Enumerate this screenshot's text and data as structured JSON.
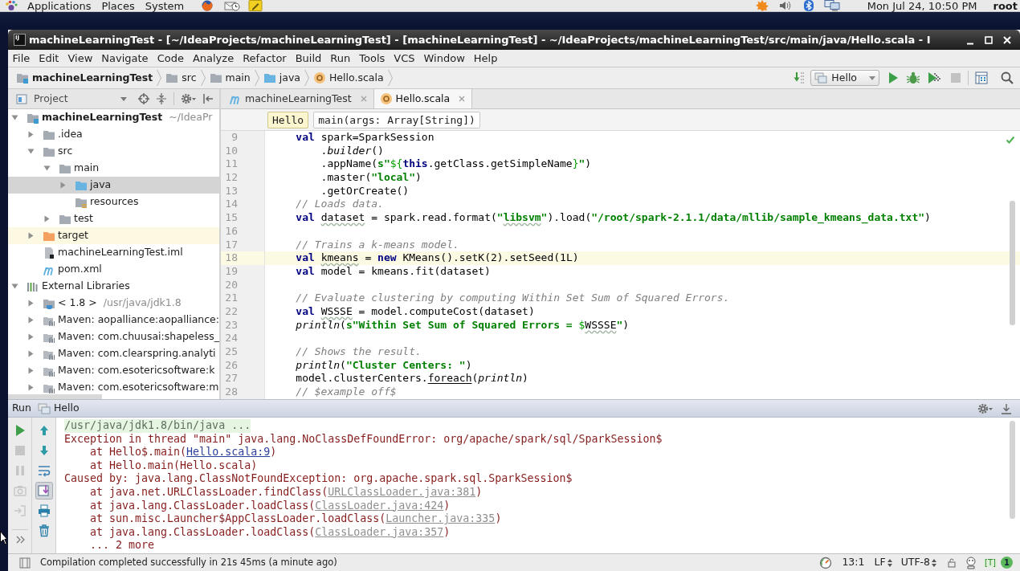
{
  "top_panel": {
    "menus": [
      "Applications",
      "Places",
      "System"
    ],
    "clock": "Mon Jul 24, 10:50 PM",
    "user": "root"
  },
  "window": {
    "icon_label": "IJ",
    "title": "machineLearningTest - [~/IdeaProjects/machineLearningTest] - [machineLearningTest] - ~/IdeaProjects/machineLearningTest/src/main/java/Hello.scala - I"
  },
  "menu_bar": [
    "File",
    "Edit",
    "View",
    "Navigate",
    "Code",
    "Analyze",
    "Refactor",
    "Build",
    "Run",
    "Tools",
    "VCS",
    "Window",
    "Help"
  ],
  "navigation_bar": {
    "breadcrumbs": [
      {
        "label": "machineLearningTest",
        "kind": "module"
      },
      {
        "label": "src",
        "kind": "folder"
      },
      {
        "label": "main",
        "kind": "folder"
      },
      {
        "label": "java",
        "kind": "source-folder"
      },
      {
        "label": "Hello.scala",
        "kind": "scala-object"
      }
    ],
    "toolbar": [
      {
        "kind": "build",
        "disabled": false
      },
      {
        "kind": "run-configuration",
        "label": "Hello",
        "disabled": false
      },
      {
        "kind": "run",
        "disabled": false
      },
      {
        "kind": "debug",
        "disabled": false
      },
      {
        "kind": "coverage",
        "disabled": false
      },
      {
        "kind": "stop",
        "disabled": true
      },
      {
        "kind": "separator"
      },
      {
        "kind": "project-structure",
        "disabled": false
      },
      {
        "kind": "search",
        "disabled": false
      }
    ]
  },
  "project_panel": {
    "title": "Project",
    "tree": [
      {
        "label": "machineLearningTest",
        "hint": "~/IdeaPr",
        "kind": "module",
        "expanded": true,
        "selected": false,
        "hovered": false,
        "children": [
          {
            "label": ".idea",
            "kind": "folder",
            "expanded": false,
            "selected": false,
            "hovered": false
          },
          {
            "label": "src",
            "kind": "folder",
            "expanded": true,
            "selected": false,
            "hovered": false,
            "children": [
              {
                "label": "main",
                "kind": "folder",
                "expanded": true,
                "selected": false,
                "hovered": false,
                "children": [
                  {
                    "label": "java",
                    "kind": "source-folder",
                    "expanded": false,
                    "selected": true,
                    "hovered": false
                  },
                  {
                    "label": "resources",
                    "kind": "resource-folder",
                    "selected": false,
                    "hovered": false
                  }
                ]
              },
              {
                "label": "test",
                "kind": "folder",
                "expanded": false,
                "selected": false,
                "hovered": false
              }
            ]
          },
          {
            "label": "target",
            "kind": "excluded-folder",
            "expanded": false,
            "selected": false,
            "hovered": true
          },
          {
            "label": "machineLearningTest.iml",
            "kind": "module-file",
            "selected": false,
            "hovered": false
          },
          {
            "label": "pom.xml",
            "kind": "maven-file",
            "selected": false,
            "hovered": false
          }
        ]
      },
      {
        "label": "External Libraries",
        "kind": "libraries",
        "expanded": true,
        "selected": false,
        "hovered": false,
        "children": [
          {
            "label": "< 1.8 >",
            "hint": "/usr/java/jdk1.8",
            "kind": "jdk",
            "expanded": false,
            "selected": false,
            "hovered": false
          },
          {
            "label": "Maven: aopalliance:aopalliance:",
            "kind": "library",
            "expanded": false,
            "selected": false,
            "hovered": false
          },
          {
            "label": "Maven: com.chuusai:shapeless_",
            "kind": "library",
            "expanded": false,
            "selected": false,
            "hovered": false
          },
          {
            "label": "Maven: com.clearspring.analyti",
            "kind": "library",
            "expanded": false,
            "selected": false,
            "hovered": false
          },
          {
            "label": "Maven: com.esotericsoftware:k",
            "kind": "library",
            "expanded": false,
            "selected": false,
            "hovered": false
          },
          {
            "label": "Maven: com.esotericsoftware:m",
            "kind": "library",
            "expanded": false,
            "selected": false,
            "hovered": false
          }
        ]
      }
    ]
  },
  "editor": {
    "tabs": [
      {
        "label": "machineLearningTest",
        "kind": "maven-file",
        "selected": false
      },
      {
        "label": "Hello.scala",
        "kind": "scala-object",
        "selected": true
      }
    ],
    "breadcrumbs": [
      {
        "label": "Hello",
        "selected": true
      },
      {
        "label": "main(args: Array[String])",
        "selected": false
      }
    ],
    "lines": [
      {
        "number": "9",
        "current": false,
        "tokens": [
          {
            "kind": "keyword",
            "text": "    val "
          },
          {
            "kind": "plain",
            "text": "spark=SparkSession"
          }
        ]
      },
      {
        "number": "10",
        "current": false,
        "tokens": [
          {
            "kind": "plain",
            "text": "        ."
          },
          {
            "kind": "method",
            "text": "builder"
          },
          {
            "kind": "plain",
            "text": "()"
          }
        ]
      },
      {
        "number": "11",
        "current": false,
        "tokens": [
          {
            "kind": "plain",
            "text": "        .appName("
          },
          {
            "kind": "string",
            "text": "s\""
          },
          {
            "kind": "interpolation",
            "text": "${"
          },
          {
            "kind": "keyword",
            "text": "this"
          },
          {
            "kind": "plain",
            "text": ".getClass.getSimpleName"
          },
          {
            "kind": "interpolation",
            "text": "}"
          },
          {
            "kind": "string",
            "text": "\""
          },
          {
            "kind": "plain",
            "text": ")"
          }
        ]
      },
      {
        "number": "12",
        "current": false,
        "tokens": [
          {
            "kind": "plain",
            "text": "        .master("
          },
          {
            "kind": "string",
            "text": "\"local\""
          },
          {
            "kind": "plain",
            "text": ")"
          }
        ]
      },
      {
        "number": "13",
        "current": false,
        "tokens": [
          {
            "kind": "plain",
            "text": "        .getOrCreate()"
          }
        ]
      },
      {
        "number": "14",
        "current": false,
        "tokens": [
          {
            "kind": "comment",
            "text": "    // Loads data."
          }
        ]
      },
      {
        "number": "15",
        "current": false,
        "tokens": [
          {
            "kind": "keyword",
            "text": "    val "
          },
          {
            "kind": "typo",
            "text": "dataset"
          },
          {
            "kind": "plain",
            "text": " = spark.read.format("
          },
          {
            "kind": "string",
            "text": "\""
          },
          {
            "kind": "string-typo",
            "text": "libsvm"
          },
          {
            "kind": "string",
            "text": "\""
          },
          {
            "kind": "plain",
            "text": ").load("
          },
          {
            "kind": "string",
            "text": "\"/root/spark-2.1.1/data/mllib/sample_kmeans_data.txt\""
          },
          {
            "kind": "plain",
            "text": ")"
          }
        ]
      },
      {
        "number": "16",
        "current": false
      },
      {
        "number": "17",
        "current": false,
        "tokens": [
          {
            "kind": "comment",
            "text": "    // Trains a k-means model."
          }
        ]
      },
      {
        "number": "18",
        "current": true,
        "tokens": [
          {
            "kind": "keyword",
            "text": "    val "
          },
          {
            "kind": "typo",
            "text": "kmeans"
          },
          {
            "kind": "plain",
            "text": " = "
          },
          {
            "kind": "keyword",
            "text": "new"
          },
          {
            "kind": "plain",
            "text": " KMeans().setK(2).setSeed(1L)"
          }
        ]
      },
      {
        "number": "19",
        "current": false,
        "tokens": [
          {
            "kind": "keyword",
            "text": "    val "
          },
          {
            "kind": "plain",
            "text": "model = kmeans.fit(dataset)"
          }
        ]
      },
      {
        "number": "20",
        "current": false
      },
      {
        "number": "21",
        "current": false,
        "tokens": [
          {
            "kind": "comment",
            "text": "    // Evaluate clustering by computing Within Set Sum of Squared Errors."
          }
        ]
      },
      {
        "number": "22",
        "current": false,
        "tokens": [
          {
            "kind": "keyword",
            "text": "    val "
          },
          {
            "kind": "typo",
            "text": "WSSSE"
          },
          {
            "kind": "plain",
            "text": " = model.computeCost(dataset)"
          }
        ]
      },
      {
        "number": "23",
        "current": false,
        "tokens": [
          {
            "kind": "method",
            "text": "    println"
          },
          {
            "kind": "plain",
            "text": "("
          },
          {
            "kind": "string",
            "text": "s\"Within Set Sum of Squared Errors = "
          },
          {
            "kind": "interpolation",
            "text": "$"
          },
          {
            "kind": "typo",
            "text": "WSSSE"
          },
          {
            "kind": "string",
            "text": "\""
          },
          {
            "kind": "plain",
            "text": ")"
          }
        ]
      },
      {
        "number": "24",
        "current": false
      },
      {
        "number": "25",
        "current": false,
        "tokens": [
          {
            "kind": "comment",
            "text": "    // Shows the result."
          }
        ]
      },
      {
        "number": "26",
        "current": false,
        "tokens": [
          {
            "kind": "method",
            "text": "    println"
          },
          {
            "kind": "plain",
            "text": "("
          },
          {
            "kind": "string",
            "text": "\"Cluster Centers: \""
          },
          {
            "kind": "plain",
            "text": ")"
          }
        ]
      },
      {
        "number": "27",
        "current": false,
        "tokens": [
          {
            "kind": "plain",
            "text": "    model.clusterCenters."
          },
          {
            "kind": "underlined",
            "text": "foreach"
          },
          {
            "kind": "plain",
            "text": "("
          },
          {
            "kind": "method",
            "text": "println"
          },
          {
            "kind": "plain",
            "text": ")"
          }
        ]
      },
      {
        "number": "28",
        "current": false,
        "tokens": [
          {
            "kind": "comment",
            "text": "    // $example off$"
          }
        ]
      }
    ]
  },
  "run_panel": {
    "title": "Run",
    "tab": "Hello",
    "toolbar": [
      {
        "kind": "rerun",
        "disabled": false
      },
      {
        "kind": "stop",
        "disabled": true
      },
      {
        "kind": "pause",
        "disabled": true
      },
      {
        "kind": "dump-threads",
        "disabled": true
      },
      {
        "kind": "exit",
        "disabled": true
      },
      {
        "kind": "separator"
      },
      {
        "kind": "more",
        "disabled": false
      }
    ],
    "console_toolbar": [
      {
        "kind": "up",
        "on": false
      },
      {
        "kind": "down",
        "on": false
      },
      {
        "kind": "soft-wrap",
        "on": false
      },
      {
        "kind": "scroll-to-end",
        "on": true
      },
      {
        "kind": "print",
        "on": false
      },
      {
        "kind": "clear",
        "on": false
      }
    ],
    "console": [
      {
        "kind": "command",
        "segments": [
          {
            "kind": "text",
            "text": "/usr/java/jdk1.8/bin/java ..."
          }
        ]
      },
      {
        "kind": "error",
        "segments": [
          {
            "kind": "text",
            "text": "Exception in thread \"main\" java.lang.NoClassDefFoundError: org/apache/spark/sql/SparkSession$"
          }
        ]
      },
      {
        "kind": "error",
        "segments": [
          {
            "kind": "text",
            "text": "    at Hello$.main("
          },
          {
            "kind": "link",
            "text": "Hello.scala:9"
          },
          {
            "kind": "text",
            "text": ")"
          }
        ]
      },
      {
        "kind": "error",
        "segments": [
          {
            "kind": "text",
            "text": "    at Hello.main(Hello.scala)"
          }
        ]
      },
      {
        "kind": "error",
        "segments": [
          {
            "kind": "text",
            "text": "Caused by: java.lang.ClassNotFoundException: org.apache.spark.sql.SparkSession$"
          }
        ]
      },
      {
        "kind": "error",
        "segments": [
          {
            "kind": "text",
            "text": "    at java.net.URLClassLoader.findClass("
          },
          {
            "kind": "library-link",
            "text": "URLClassLoader.java:381"
          },
          {
            "kind": "text",
            "text": ")"
          }
        ]
      },
      {
        "kind": "error",
        "segments": [
          {
            "kind": "text",
            "text": "    at java.lang.ClassLoader.loadClass("
          },
          {
            "kind": "library-link",
            "text": "ClassLoader.java:424"
          },
          {
            "kind": "text",
            "text": ")"
          }
        ]
      },
      {
        "kind": "error",
        "segments": [
          {
            "kind": "text",
            "text": "    at sun.misc.Launcher$AppClassLoader.loadClass("
          },
          {
            "kind": "library-link",
            "text": "Launcher.java:335"
          },
          {
            "kind": "text",
            "text": ")"
          }
        ]
      },
      {
        "kind": "error",
        "segments": [
          {
            "kind": "text",
            "text": "    at java.lang.ClassLoader.loadClass("
          },
          {
            "kind": "library-link",
            "text": "ClassLoader.java:357"
          },
          {
            "kind": "text",
            "text": ")"
          }
        ]
      },
      {
        "kind": "error",
        "segments": [
          {
            "kind": "text",
            "text": "    ... 2 more"
          }
        ]
      }
    ]
  },
  "status_bar": {
    "message": "Compilation completed successfully in 21s 45ms (a minute ago)",
    "position": "13:1",
    "line_separator": "LF",
    "encoding": "UTF-8",
    "indicator": "[T]",
    "notifications": "1"
  }
}
